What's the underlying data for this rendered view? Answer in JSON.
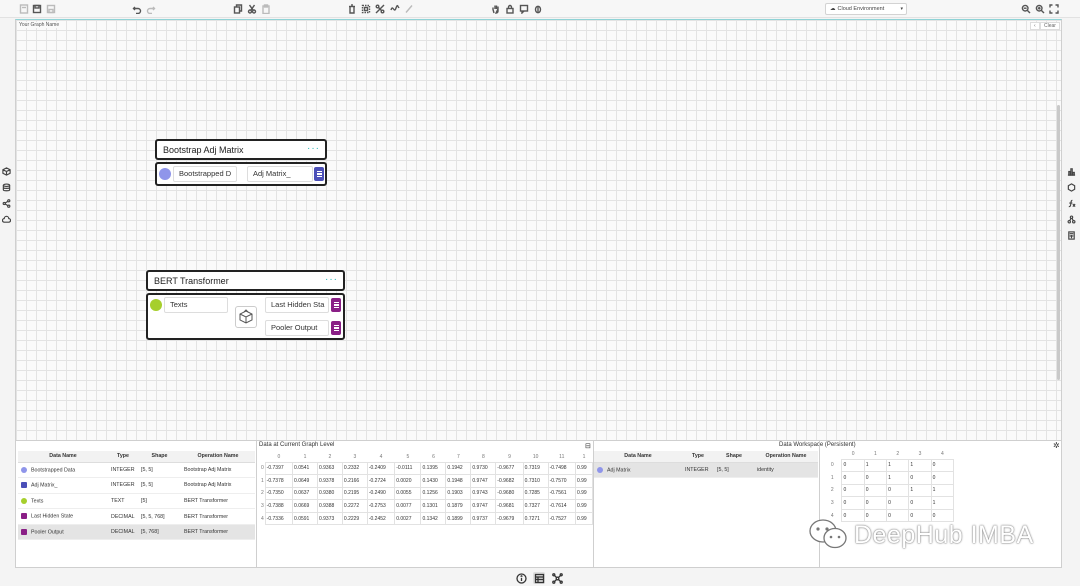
{
  "toolbar": {
    "left_icons": [
      "new-file-icon",
      "save-icon",
      "save-as-icon"
    ],
    "edit_icons": [
      "undo-icon",
      "redo-icon",
      "copy-icon",
      "cut-icon",
      "paste-icon"
    ],
    "tool_icons": [
      "delete-icon",
      "select-icon",
      "disconnect-icon",
      "function-icon",
      "pen-icon",
      "hand-icon",
      "lock-icon",
      "comment-icon",
      "bug-icon"
    ],
    "environment_label": "Cloud Environment",
    "right_icons": [
      "zoom-out-icon",
      "zoom-in-icon",
      "fit-screen-icon"
    ]
  },
  "canvas": {
    "graph_name": "Your Graph Name",
    "collapse_label": "‹",
    "clear_label": "Clear"
  },
  "nodes": {
    "bootstrap": {
      "title": "Bootstrap Adj Matrix",
      "menu": "···",
      "input_label": "Bootstrapped D",
      "output_label": "Adj Matrix_",
      "input_color": "#8f95ea",
      "output_color": "#4b4fb8"
    },
    "bert": {
      "title": "BERT Transformer",
      "menu": "···",
      "input_label": "Texts",
      "output1_label": "Last Hidden Sta",
      "output2_label": "Pooler Output",
      "input_color": "#a6cf2c",
      "output_color": "#8a1f86"
    }
  },
  "data_table": {
    "headers": [
      "Data Name",
      "Type",
      "Shape",
      "Operation Name"
    ],
    "rows": [
      {
        "name": "Bootstrapped Data",
        "type": "INTEGER",
        "shape": "[5, 5]",
        "op": "Bootstrap Adj Matrix",
        "marker": "circle",
        "color": "#8f95ea"
      },
      {
        "name": "Adj Matrix_",
        "type": "INTEGER",
        "shape": "[5, 5]",
        "op": "Bootstrap Adj Matrix",
        "marker": "square",
        "color": "#4b4fb8"
      },
      {
        "name": "Texts",
        "type": "TEXT",
        "shape": "[5]",
        "op": "BERT Transformer",
        "marker": "circle",
        "color": "#a6cf2c"
      },
      {
        "name": "Last Hidden State",
        "type": "DECIMAL",
        "shape": "[5, 5, 768]",
        "op": "BERT Transformer",
        "marker": "square",
        "color": "#8a1f86"
      },
      {
        "name": "Pooler Output",
        "type": "DECIMAL",
        "shape": "[5, 768]",
        "op": "BERT Transformer",
        "marker": "square",
        "color": "#8a1f86"
      }
    ]
  },
  "graph_level": {
    "title": "Data at Current Graph Level",
    "columns": [
      "0",
      "1",
      "2",
      "3",
      "4",
      "5",
      "6",
      "7",
      "8",
      "9",
      "10",
      "11",
      "1"
    ],
    "rows": [
      [
        "0",
        "-0.7397",
        "0.0541",
        "0.9363",
        "0.2332",
        "-0.2409",
        "-0.0111",
        "0.1395",
        "0.1942",
        "0.9730",
        "-0.9677",
        "0.7319",
        "-0.7498",
        "0.99"
      ],
      [
        "1",
        "-0.7378",
        "0.0649",
        "0.9378",
        "0.2166",
        "-0.2724",
        "0.0020",
        "0.1430",
        "0.1948",
        "0.9747",
        "-0.9682",
        "0.7310",
        "-0.7570",
        "0.99"
      ],
      [
        "2",
        "-0.7350",
        "0.0637",
        "0.9380",
        "0.2195",
        "-0.2490",
        "0.0055",
        "0.1256",
        "0.1903",
        "0.9743",
        "-0.9680",
        "0.7285",
        "-0.7561",
        "0.99"
      ],
      [
        "3",
        "-0.7388",
        "0.0669",
        "0.9388",
        "0.2272",
        "-0.2753",
        "0.0077",
        "0.1301",
        "0.1879",
        "0.9747",
        "-0.9681",
        "0.7327",
        "-0.7614",
        "0.99"
      ],
      [
        "4",
        "-0.7336",
        "0.0591",
        "0.9373",
        "0.2229",
        "-0.2452",
        "0.0027",
        "0.1342",
        "0.1899",
        "0.9737",
        "-0.9679",
        "0.7271",
        "-0.7527",
        "0.99"
      ]
    ]
  },
  "workspace": {
    "title": "Data Workspace (Persistent)",
    "headers": [
      "Data Name",
      "Type",
      "Shape",
      "Operation Name"
    ],
    "rows": [
      {
        "name": "Adj Matrix",
        "type": "INTEGER",
        "shape": "[5, 5]",
        "op": "identity",
        "color": "#8f95ea"
      }
    ],
    "matrix_columns": [
      "0",
      "1",
      "2",
      "3",
      "4"
    ],
    "matrix": [
      [
        "0",
        "0",
        "1",
        "1",
        "1",
        "0"
      ],
      [
        "1",
        "0",
        "0",
        "1",
        "0",
        "0"
      ],
      [
        "2",
        "0",
        "0",
        "0",
        "1",
        "1"
      ],
      [
        "3",
        "0",
        "0",
        "0",
        "0",
        "1"
      ],
      [
        "4",
        "0",
        "0",
        "0",
        "0",
        "0"
      ]
    ]
  },
  "watermark": "DeepHub IMBA",
  "footer_icons": [
    "info-icon",
    "table-icon",
    "graph-icon"
  ]
}
